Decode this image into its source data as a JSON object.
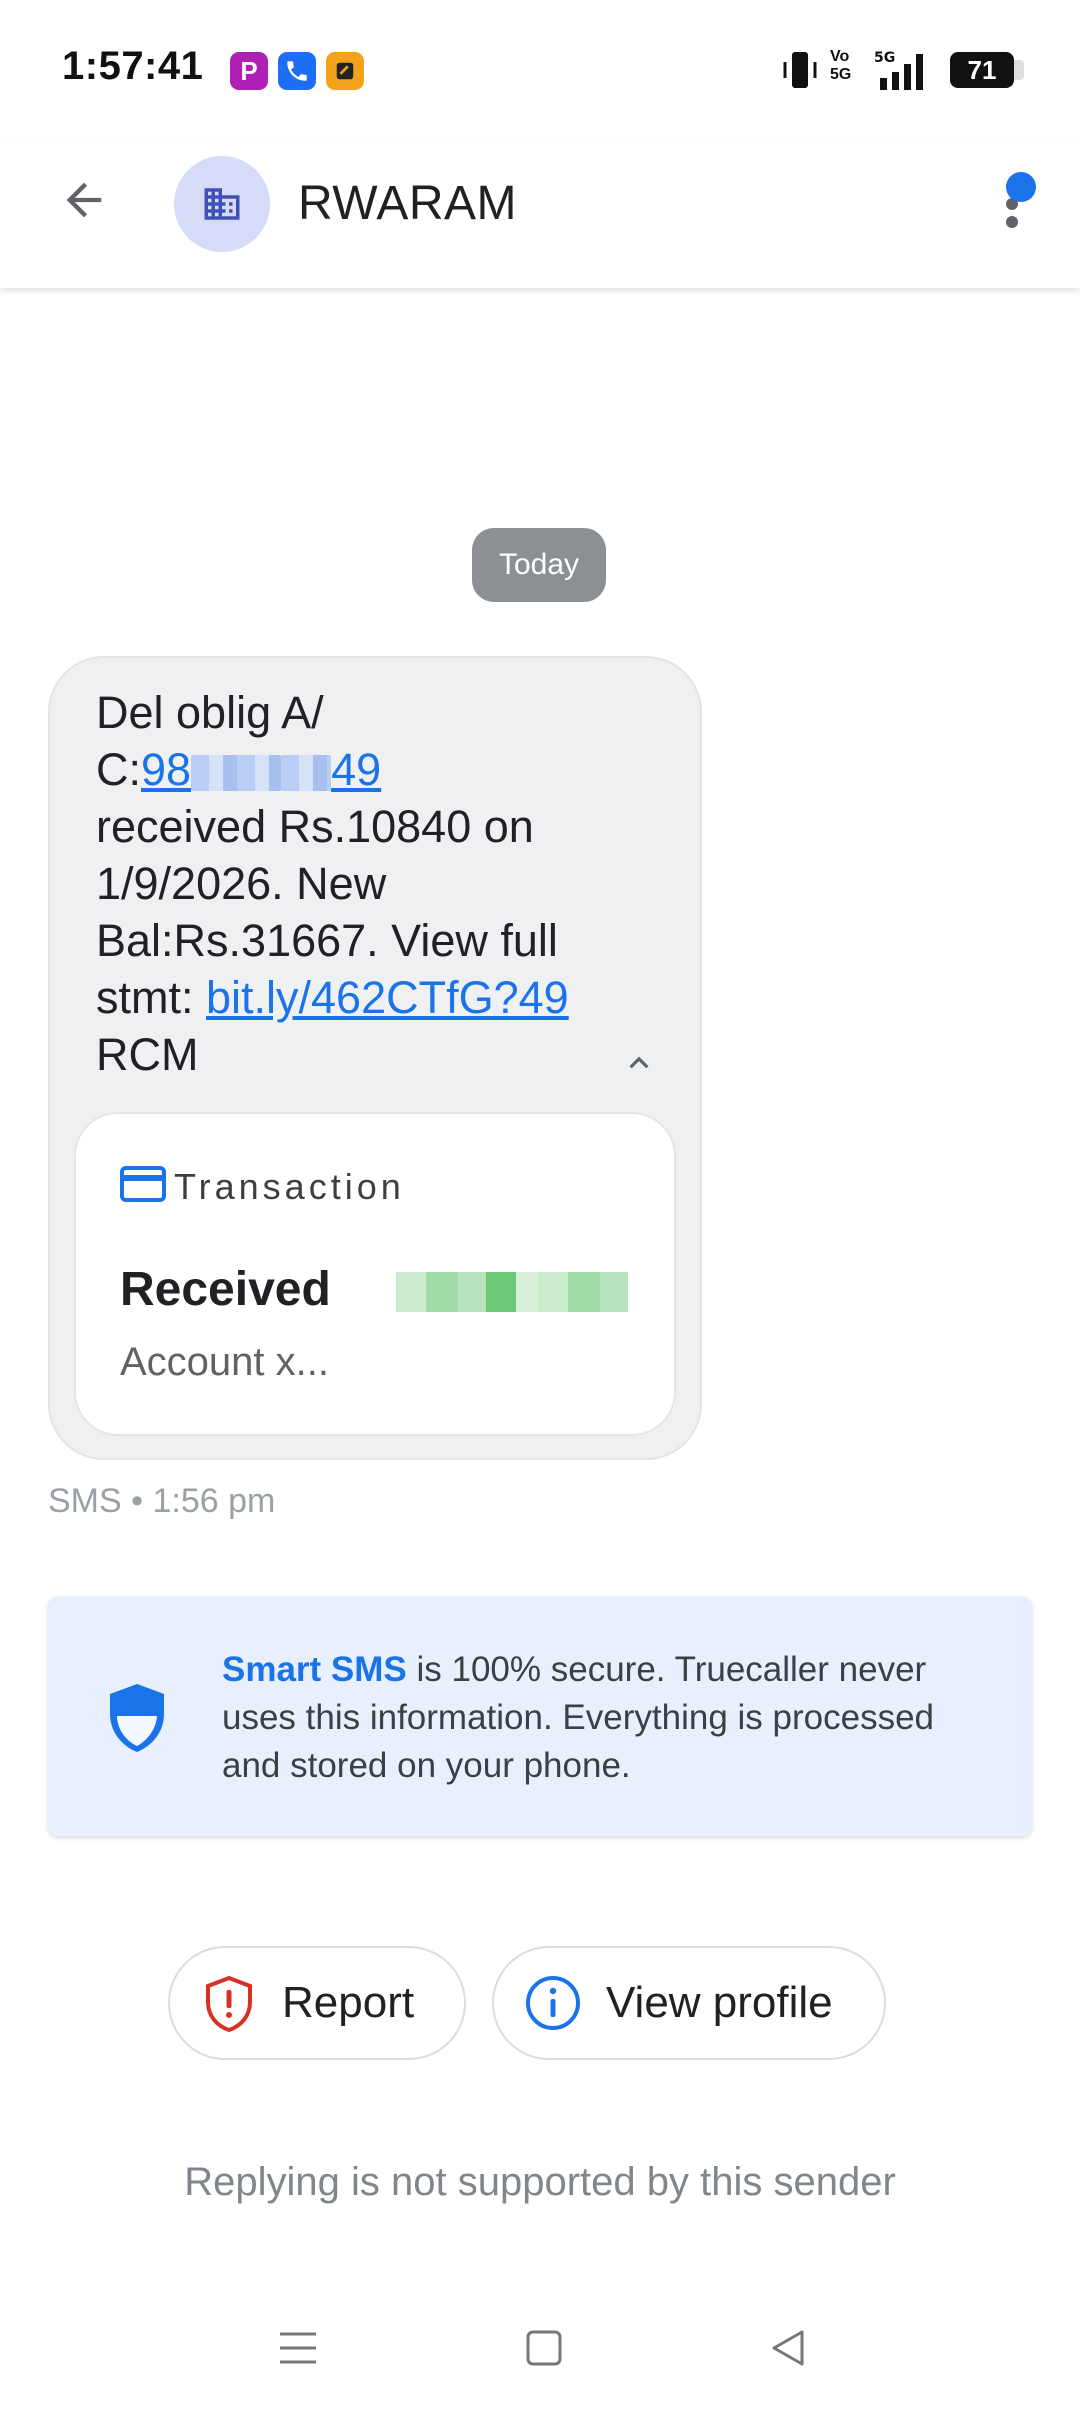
{
  "status_bar": {
    "time": "1:57:41",
    "notification_icons": [
      "p-app-icon",
      "phone-app-icon",
      "wallet-app-icon"
    ],
    "network": "5G",
    "volte": "Vo 5G",
    "battery": "71"
  },
  "header": {
    "sender": "RWARAM",
    "back_icon": "arrow-back-icon",
    "avatar_icon": "building-icon",
    "menu_icon": "more-vert-icon"
  },
  "conversation": {
    "date_chip": "Today",
    "message": {
      "line1": "Del oblig A/",
      "acct_prefix": "C:",
      "acct_start": "98",
      "acct_end": "49",
      "line3": "received Rs.10840 on",
      "line4": "1/9/2026. New",
      "line5": "Bal:Rs.31667. View full",
      "stmt_label": "stmt: ",
      "stmt_link": "bit.ly/462CTfG?49",
      "line7": "RCM"
    },
    "card": {
      "label": "Transaction",
      "title": "Received",
      "subtitle": "Account x..."
    },
    "meta": "SMS • 1:56 pm"
  },
  "info_banner": {
    "brand": "Smart SMS",
    "text": " is 100% secure. Truecaller never uses this information. Everything is processed and stored on your phone."
  },
  "actions": {
    "report": "Report",
    "view_profile": "View profile"
  },
  "reply_note": "Replying is not supported by this sender",
  "colors": {
    "accent": "#1a73e8",
    "danger": "#d93025",
    "bubble": "#eef0f1",
    "banner": "#e8f0fd"
  }
}
